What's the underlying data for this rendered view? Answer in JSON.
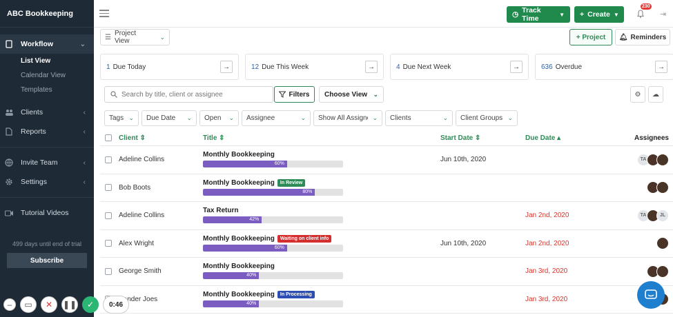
{
  "sidebar": {
    "brand": "ABC Bookkeeping",
    "workflow": "Workflow",
    "sub_items": [
      "List View",
      "Calendar View",
      "Templates"
    ],
    "clients": "Clients",
    "reports": "Reports",
    "invite_team": "Invite Team",
    "settings": "Settings",
    "tutorial_videos": "Tutorial Videos",
    "trial_text": "499 days until end of trial",
    "subscribe": "Subscribe"
  },
  "recorder": {
    "timer": "0:46"
  },
  "topbar": {
    "track_time": "Track Time",
    "create": "Create",
    "notification_count": "230"
  },
  "toolbar": {
    "project_view": "Project View",
    "project_button": "+ Project",
    "reminders": "Reminders"
  },
  "cards": [
    {
      "num": "1",
      "label": "Due Today"
    },
    {
      "num": "12",
      "label": "Due This Week"
    },
    {
      "num": "4",
      "label": "Due Next Week"
    },
    {
      "num": "636",
      "label": "Overdue"
    }
  ],
  "search": {
    "placeholder": "Search by title, client or assignee",
    "filters": "Filters",
    "choose_view": "Choose View"
  },
  "filters": [
    "Tags",
    "Due Date",
    "Open",
    "Assignee",
    "Show All Assignees",
    "Clients",
    "Client Groups"
  ],
  "table": {
    "headers": {
      "client": "Client",
      "title": "Title",
      "start_date": "Start Date",
      "due_date": "Due Date",
      "assignees": "Assignees"
    },
    "rows": [
      {
        "client": "Adeline Collins",
        "title": "Monthly Bookkeeping",
        "tag": "",
        "tag_color": "",
        "progress": 60,
        "progress_label": "60%",
        "start": "Jun 10th, 2020",
        "due": "",
        "assignees": [
          "TA",
          "photo",
          "photo"
        ]
      },
      {
        "client": "Bob Boots",
        "title": "Monthly Bookkeeping",
        "tag": "In Review",
        "tag_color": "#2e8b57",
        "progress": 80,
        "progress_label": "80%",
        "start": "",
        "due": "",
        "assignees": [
          "photo",
          "photo"
        ]
      },
      {
        "client": "Adeline Collins",
        "title": "Tax Return",
        "tag": "",
        "tag_color": "",
        "progress": 42,
        "progress_label": "42%",
        "start": "",
        "due": "Jan 2nd, 2020",
        "assignees": [
          "TA",
          "photo",
          "JL"
        ]
      },
      {
        "client": "Alex Wright",
        "title": "Monthly Bookkeeping",
        "tag": "Waiting on client info",
        "tag_color": "#d32f2f",
        "progress": 60,
        "progress_label": "60%",
        "start": "Jun 10th, 2020",
        "due": "Jan 2nd, 2020",
        "assignees": [
          "photo"
        ]
      },
      {
        "client": "George Smith",
        "title": "Monthly Bookkeeping",
        "tag": "",
        "tag_color": "",
        "progress": 40,
        "progress_label": "40%",
        "start": "",
        "due": "Jan 3rd, 2020",
        "assignees": [
          "photo",
          "photo"
        ]
      },
      {
        "client": "Xander Joes",
        "title": "Monthly Bookkeeping",
        "tag": "In Processing",
        "tag_color": "#2d4fb3",
        "progress": 40,
        "progress_label": "40%",
        "start": "",
        "due": "Jan 3rd, 2020",
        "assignees": [
          "TA",
          "photo",
          "photo"
        ]
      }
    ]
  },
  "colors": {
    "sidebar_bg": "#1e2a36",
    "accent_green": "#2e8b57",
    "progress_purple": "#7b5cc0",
    "overdue_red": "#d9342b"
  },
  "icons": [
    "workflow-icon",
    "clients-icon",
    "reports-icon",
    "invite-icon",
    "settings-icon",
    "video-icon",
    "bell-icon",
    "logout-icon",
    "settings-gear-icon",
    "cloud-icon",
    "chat-icon"
  ]
}
